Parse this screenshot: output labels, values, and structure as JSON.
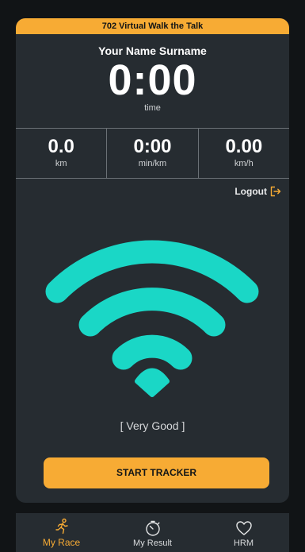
{
  "event": {
    "banner_title": "702 Virtual Walk the Talk",
    "participant_name": "Your Name Surname"
  },
  "timer": {
    "value": "0:00",
    "label": "time"
  },
  "stats": [
    {
      "value": "0.0",
      "unit": "km"
    },
    {
      "value": "0:00",
      "unit": "min/km"
    },
    {
      "value": "0.00",
      "unit": "km/h"
    }
  ],
  "logout": {
    "label": "Logout",
    "icon": "logout-icon"
  },
  "signal": {
    "icon": "wifi-signal-icon",
    "status_text": "[ Very Good ]"
  },
  "actions": {
    "start_label": "START TRACKER"
  },
  "tabs": [
    {
      "label": "My Race",
      "icon": "runner-icon",
      "active": true
    },
    {
      "label": "My Result",
      "icon": "stopwatch-icon",
      "active": false
    },
    {
      "label": "HRM",
      "icon": "heart-icon",
      "active": false
    }
  ],
  "colors": {
    "accent": "#f7ab34",
    "signal": "#1ad7c6",
    "card_background": "#262c31",
    "app_background": "#111416"
  }
}
